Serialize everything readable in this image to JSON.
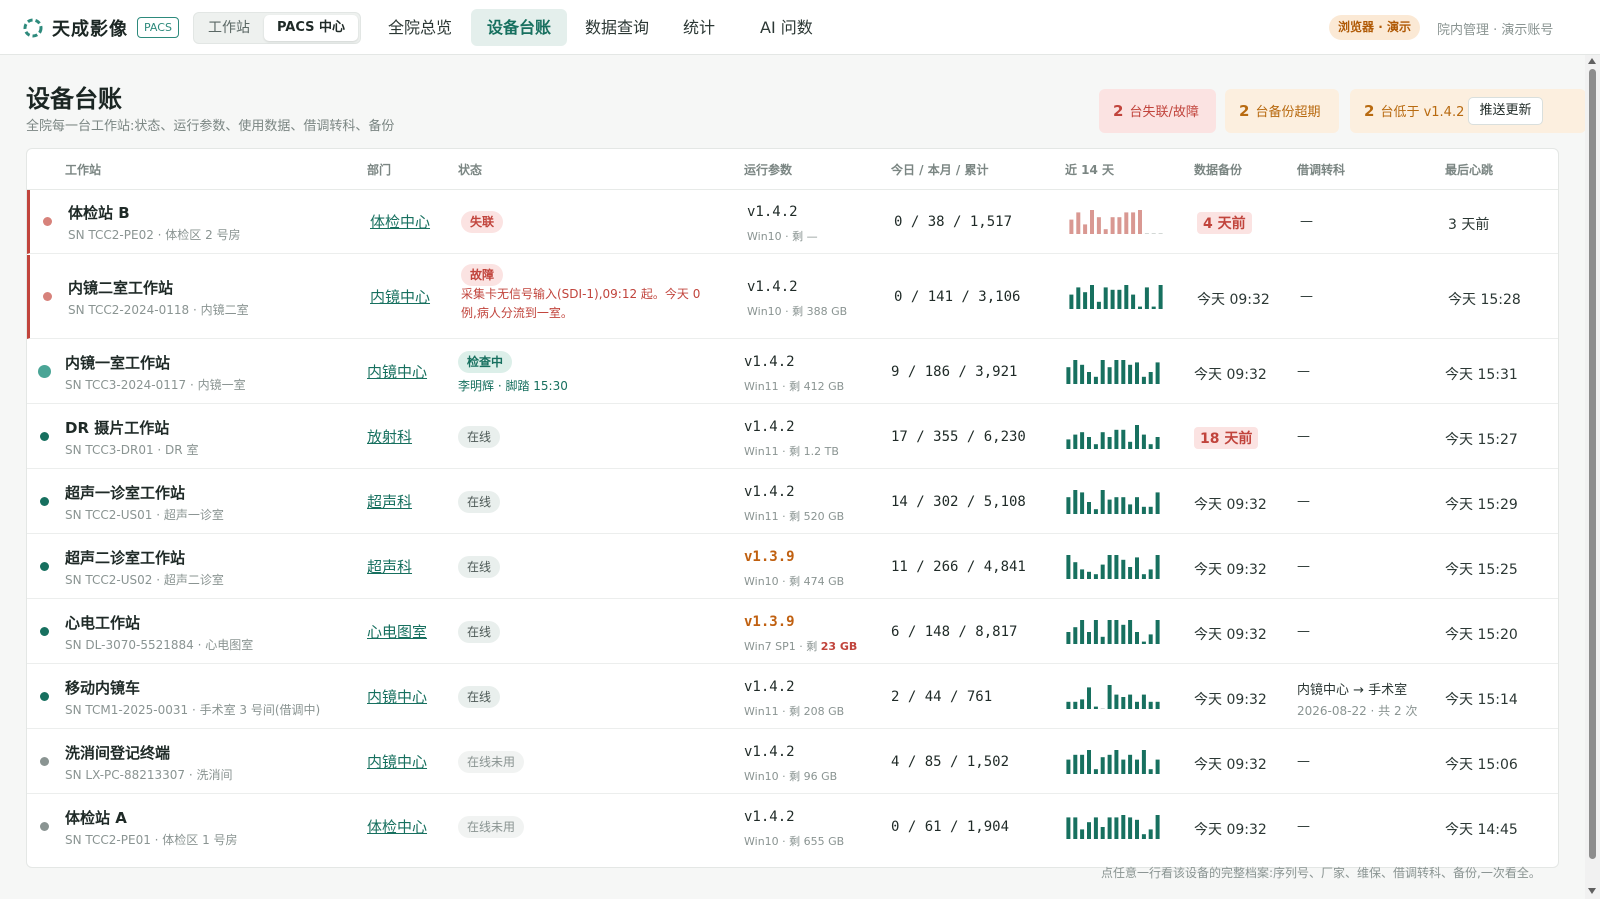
{
  "app": {
    "brand": "天成影像",
    "tag": "PACS",
    "mode_switch": [
      "工作站",
      "PACS 中心"
    ],
    "nav": [
      "全院总览",
      "设备台账",
      "数据查询",
      "统计",
      "AI 问数"
    ],
    "active_nav": "设备台账",
    "demo_badge": "浏览器 · 演示",
    "user": "院内管理 · 演示账号"
  },
  "colors": {
    "accent": "#17705f",
    "danger": "#c1443c",
    "warning": "#b86a10",
    "online": "#17705f",
    "idle": "#8a9492"
  },
  "page": {
    "title": "设备台账",
    "subtitle": "全院每一台工作站:状态、运行参数、使用数据、借调转科、备份"
  },
  "alerts": [
    {
      "count": "2",
      "text": "台失联/故障"
    },
    {
      "count": "2",
      "text": "台备份超期"
    },
    {
      "count": "2",
      "text": "台低于 v1.4.2"
    }
  ],
  "push_button": "推送更新",
  "table": {
    "headers": [
      "工作站",
      "部门",
      "状态",
      "运行参数",
      "今日 / 本月 / 累计",
      "近 14 天",
      "数据备份",
      "借调转科",
      "最后心跳"
    ],
    "rows": [
      {
        "name": "体检站 B",
        "sn": "SN TCC2-PE02 · 体检区 2 号房",
        "dept": "体检中心",
        "status": "失联",
        "status_note": "",
        "version": "v1.4.2",
        "os": "Win10 · 剩 —",
        "os_low": "",
        "counts": "0 / 38 / 1,517",
        "spark": [
          6,
          9,
          4,
          11,
          7,
          2,
          7,
          7,
          9,
          9,
          11,
          0,
          0,
          0
        ],
        "backup": "4 天前",
        "loan": "—",
        "loan_sub": "",
        "heartbeat": "3 天前"
      },
      {
        "name": "内镜二室工作站",
        "sn": "SN TCC2-2024-0118 · 内镜二室",
        "dept": "内镜中心",
        "status": "故障",
        "status_note": "采集卡无信号输入(SDI-1),09:12 起。今天 0 例,病人分流到一室。",
        "version": "v1.4.2",
        "os": "Win10 · 剩 388 GB",
        "os_low": "",
        "counts": "0 / 141 / 3,106",
        "spark": [
          6,
          9,
          7,
          10,
          3,
          9,
          8,
          8,
          10,
          6,
          1,
          9,
          1,
          10
        ],
        "backup": "今天 09:32",
        "loan": "—",
        "loan_sub": "",
        "heartbeat": "今天 15:28"
      },
      {
        "name": "内镜一室工作站",
        "sn": "SN TCC3-2024-0117 · 内镜一室",
        "dept": "内镜中心",
        "status": "检查中",
        "status_note": "李明辉 · 脚踏 15:30",
        "version": "v1.4.2",
        "os": "Win11 · 剩 412 GB",
        "os_low": "",
        "counts": "9 / 186 / 3,921",
        "spark": [
          7,
          10,
          8,
          5,
          3,
          10,
          7,
          10,
          10,
          8,
          9,
          3,
          5,
          9
        ],
        "backup": "今天 09:32",
        "loan": "—",
        "loan_sub": "",
        "heartbeat": "今天 15:31"
      },
      {
        "name": "DR 摄片工作站",
        "sn": "SN TCC3-DR01 · DR 室",
        "dept": "放射科",
        "status": "在线",
        "status_note": "",
        "version": "v1.4.2",
        "os": "Win11 · 剩 1.2 TB",
        "os_low": "",
        "counts": "17 / 355 / 6,230",
        "spark": [
          4,
          6,
          7,
          5,
          2,
          7,
          5,
          8,
          8,
          3,
          10,
          6,
          2,
          5
        ],
        "backup": "18 天前",
        "loan": "—",
        "loan_sub": "",
        "heartbeat": "今天 15:27"
      },
      {
        "name": "超声一诊室工作站",
        "sn": "SN TCC2-US01 · 超声一诊室",
        "dept": "超声科",
        "status": "在线",
        "status_note": "",
        "version": "v1.4.2",
        "os": "Win11 · 剩 520 GB",
        "os_low": "",
        "counts": "14 / 302 / 5,108",
        "spark": [
          7,
          10,
          9,
          5,
          2,
          10,
          6,
          7,
          7,
          4,
          7,
          3,
          3,
          9
        ],
        "backup": "今天 09:32",
        "loan": "—",
        "loan_sub": "",
        "heartbeat": "今天 15:29"
      },
      {
        "name": "超声二诊室工作站",
        "sn": "SN TCC2-US02 · 超声二诊室",
        "dept": "超声科",
        "status": "在线",
        "status_note": "",
        "version": "v1.3.9",
        "os": "Win10 · 剩 474 GB",
        "os_low": "",
        "counts": "11 / 266 / 4,841",
        "spark": [
          10,
          7,
          4,
          3,
          2,
          6,
          10,
          10,
          8,
          5,
          9,
          2,
          4,
          10
        ],
        "backup": "今天 09:32",
        "loan": "—",
        "loan_sub": "",
        "heartbeat": "今天 15:25"
      },
      {
        "name": "心电工作站",
        "sn": "SN DL-3070-5521884 · 心电图室",
        "dept": "心电图室",
        "status": "在线",
        "status_note": "",
        "version": "v1.3.9",
        "os": "Win7 SP1 · 剩 ",
        "os_low": "23 GB",
        "counts": "6 / 148 / 8,817",
        "spark": [
          5,
          7,
          10,
          5,
          10,
          3,
          10,
          10,
          8,
          10,
          5,
          1,
          4,
          10
        ],
        "backup": "今天 09:32",
        "loan": "—",
        "loan_sub": "",
        "heartbeat": "今天 15:20"
      },
      {
        "name": "移动内镜车",
        "sn": "SN TCM1-2025-0031 · 手术室 3 号间(借调中)",
        "dept": "内镜中心",
        "status": "在线",
        "status_note": "",
        "version": "v1.4.2",
        "os": "Win11 · 剩 208 GB",
        "os_low": "",
        "counts": "2 / 44 / 761",
        "spark": [
          3,
          3,
          4,
          9,
          1,
          0,
          10,
          6,
          5,
          6,
          3,
          6,
          3,
          3
        ],
        "backup": "今天 09:32",
        "loan": "内镜中心 → 手术室",
        "loan_sub": "2026-08-22 · 共 2 次",
        "heartbeat": "今天 15:14"
      },
      {
        "name": "洗消间登记终端",
        "sn": "SN LX-PC-88213307 · 洗消间",
        "dept": "内镜中心",
        "status": "在线未用",
        "status_note": "",
        "version": "v1.4.2",
        "os": "Win10 · 剩 96 GB",
        "os_low": "",
        "counts": "4 / 85 / 1,502",
        "spark": [
          6,
          8,
          8,
          10,
          2,
          7,
          8,
          10,
          6,
          8,
          6,
          10,
          2,
          6
        ],
        "backup": "今天 09:32",
        "loan": "—",
        "loan_sub": "",
        "heartbeat": "今天 15:06"
      },
      {
        "name": "体检站 A",
        "sn": "SN TCC2-PE01 · 体检区 1 号房",
        "dept": "体检中心",
        "status": "在线未用",
        "status_note": "",
        "version": "v1.4.2",
        "os": "Win10 · 剩 655 GB",
        "os_low": "",
        "counts": "0 / 61 / 1,904",
        "spark": [
          9,
          9,
          4,
          7,
          9,
          5,
          9,
          9,
          10,
          9,
          8,
          2,
          4,
          10
        ],
        "backup": "今天 09:32",
        "loan": "—",
        "loan_sub": "",
        "heartbeat": "今天 14:45"
      }
    ]
  },
  "footer_note": "点任意一行看该设备的完整档案:序列号、厂家、维保、借调转科、备份,一次看全。"
}
